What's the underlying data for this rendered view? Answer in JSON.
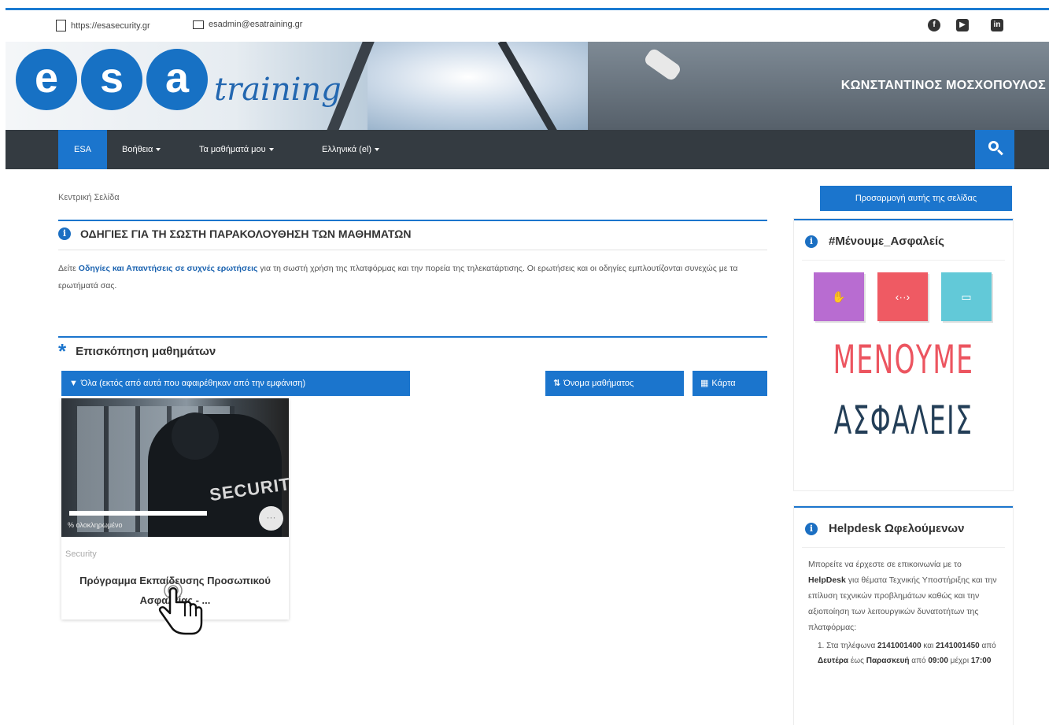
{
  "topbar": {
    "website": "https://esasecurity.gr",
    "email": "esadmin@esatraining.gr",
    "social": [
      "facebook-icon",
      "youtube-icon",
      "linkedin-icon"
    ]
  },
  "banner": {
    "logo_letters": [
      "e",
      "s",
      "a"
    ],
    "logo_word": "training",
    "user_name": "ΚΩΝΣΤΑΝΤΙΝΟΣ ΜΟΣΧΟΠΟΥΛΟΣ"
  },
  "nav": {
    "items": [
      {
        "label": "ESA",
        "active": true
      },
      {
        "label": "Βοήθεια",
        "dropdown": true
      },
      {
        "label": "Τα μαθήματά μου",
        "dropdown": true
      },
      {
        "label": "Ελληνικά (el)",
        "dropdown": true
      }
    ],
    "search_icon": "search-icon"
  },
  "breadcrumb": "Κεντρική Σελίδα",
  "instructions": {
    "title": "ΟΔΗΓΙΕΣ ΓΙΑ ΤΗ ΣΩΣΤΗ ΠΑΡΑΚΟΛΟΥΘΗΣΗ ΤΩΝ ΜΑΘΗΜΑΤΩΝ",
    "text_before": "Δείτε ",
    "link": "Οδηγίες και Απαντήσεις σε συχνές ερωτήσεις",
    "text_after": " για τη σωστή χρήση της πλατφόρμας και την πορεία της τηλεκατάρτισης. Οι ερωτήσεις και οι οδηγίες εμπλουτίζονται συνεχώς με τα ερωτήματά σας."
  },
  "overview": {
    "title": "Επισκόπηση μαθημάτων",
    "filter_button": "Όλα (εκτός από αυτά που αφαιρέθηκαν από την εμφάνιση)",
    "sort_button": "Όνομα μαθήματος",
    "view_button": "Κάρτα"
  },
  "course": {
    "image_text": "SECURITY",
    "progress_label": "% ολοκληρωμένο",
    "more_label": "···",
    "category": "Security",
    "title": "Πρόγραμμα Εκπαίδευσης Προσωπικού Ασφαλείας - ..."
  },
  "sidebar": {
    "customize_button": "Προσαρμογή αυτής της σελίδας",
    "stay_safe": {
      "title": "#Μένουμε_Ασφαλείς",
      "poster_line1": "ΜΕΝΟΥΜΕ",
      "poster_line2": "ΑΣΦΑΛΕΙΣ",
      "tile_colors": [
        "#b86cd1",
        "#ef5a63",
        "#62c9d8"
      ]
    },
    "helpdesk": {
      "title": "Helpdesk Ωφελούμενων",
      "text_1": "Μπορείτε να έρχεστε σε επικοινωνία με το ",
      "text_bold": "HelpDesk",
      "text_2": " για θέματα Τεχνικής Υποστήριξης και την επίλυση τεχνικών προβλημάτων καθώς και την αξιοποίηση των λειτουργικών δυνατοτήτων της πλατφόρμας:",
      "item_prefix": "1. Στα τηλέφωνα ",
      "phone_1": "2141001400",
      "and": " και ",
      "phone_2": "2141001450",
      "from": " από ",
      "day_from": "Δευτέρα",
      "until": " έως ",
      "day_to": "Παρασκευή",
      "from_time_prefix": " από ",
      "time_from": "09:00",
      "until_time": " μέχρι ",
      "time_to": "17:00"
    }
  },
  "colors": {
    "primary": "#1b75cd",
    "nav_bg": "#343b41",
    "link": "#1b63b0"
  }
}
